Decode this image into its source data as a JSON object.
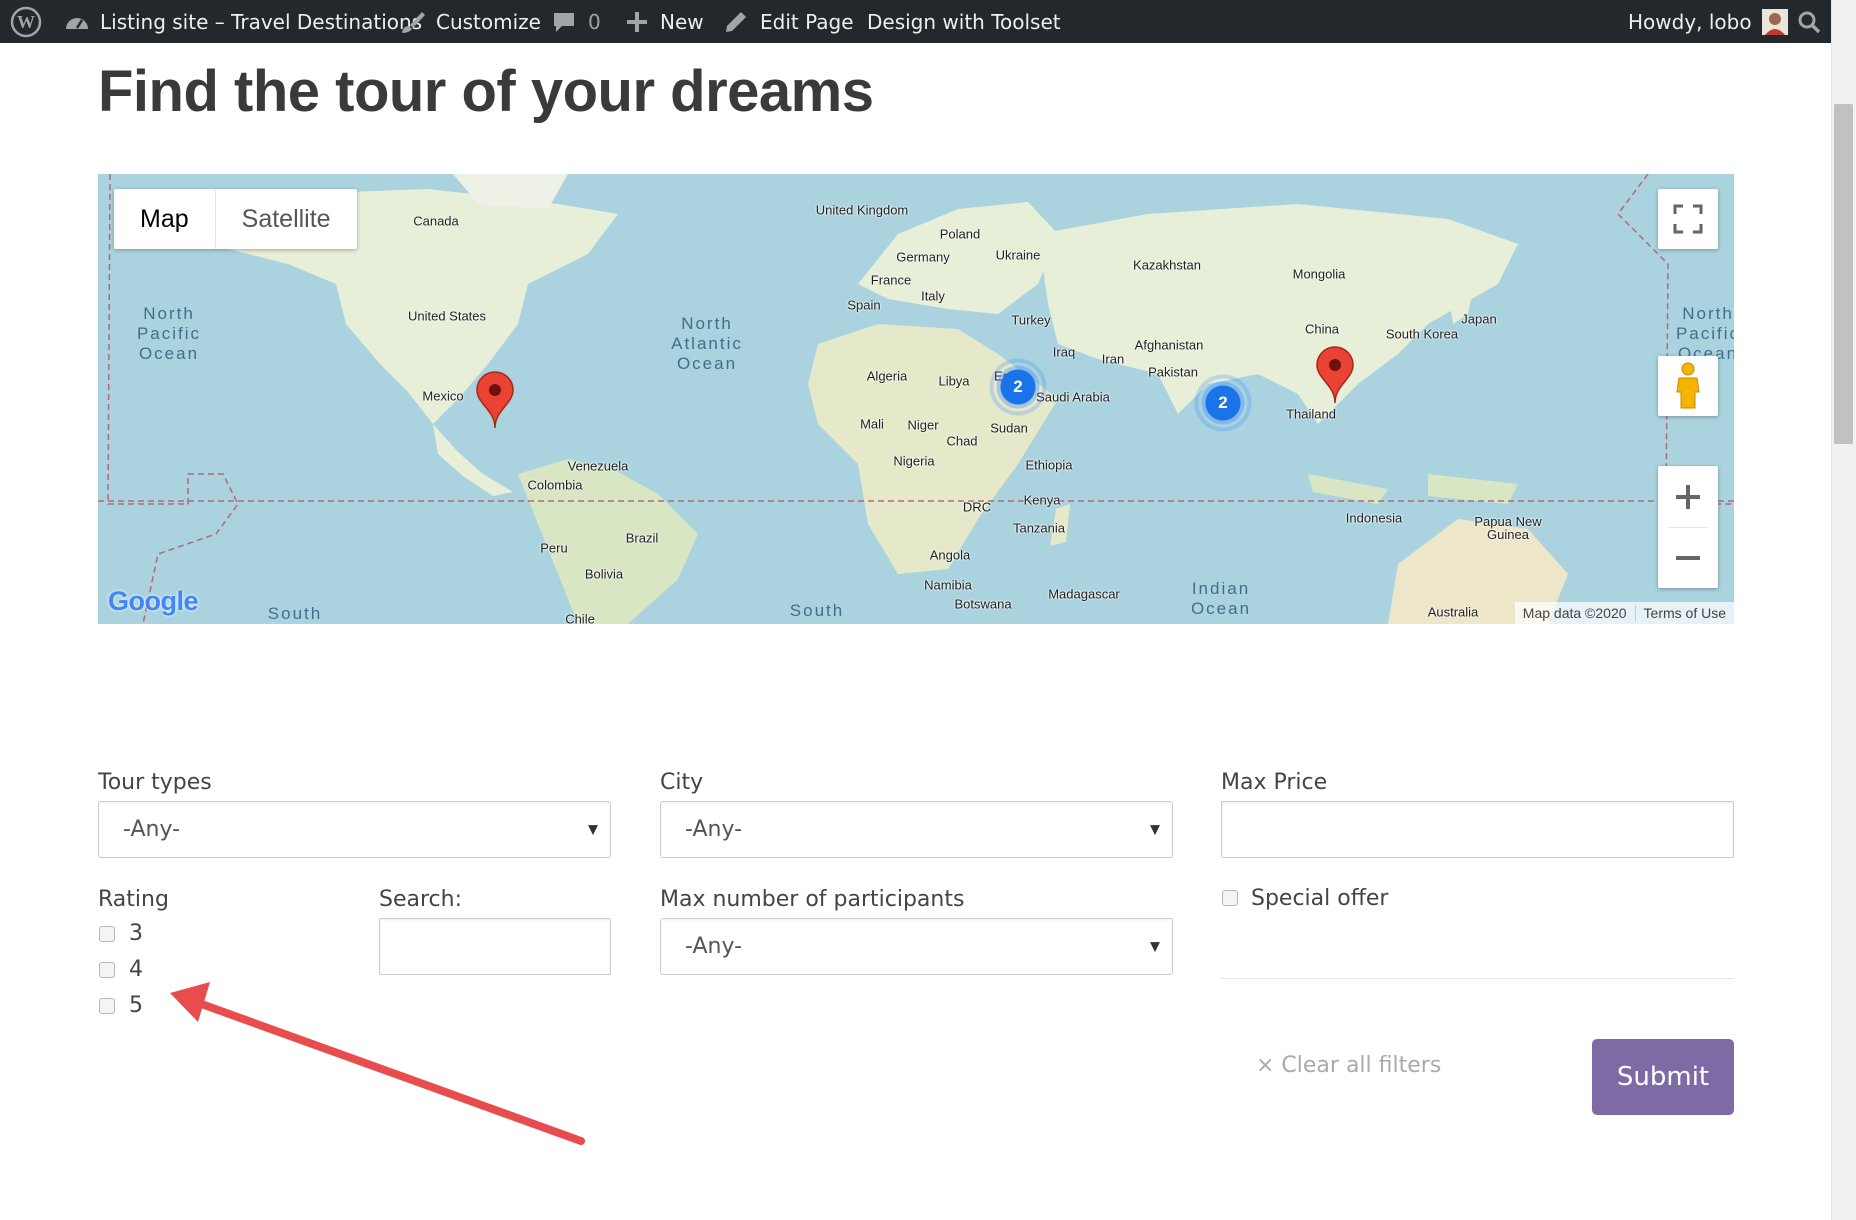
{
  "adminbar": {
    "site_name": "Listing site – Travel Destinations",
    "customize": "Customize",
    "comments_count": "0",
    "new": "New",
    "edit_page": "Edit Page",
    "toolset": "Design with Toolset",
    "howdy": "Howdy, lobo"
  },
  "page": {
    "title": "Find the tour of your dreams"
  },
  "map": {
    "type_map": "Map",
    "type_satellite": "Satellite",
    "attribution": "Map data ©2020",
    "terms": "Terms of Use",
    "logo": "Google",
    "clusters": [
      "2",
      "2"
    ],
    "countries": [
      "Canada",
      "United States",
      "Mexico",
      "Venezuela",
      "Colombia",
      "Peru",
      "Brazil",
      "Bolivia",
      "Chile",
      "United Kingdom",
      "Poland",
      "Germany",
      "Ukraine",
      "France",
      "Italy",
      "Spain",
      "Turkey",
      "Algeria",
      "Libya",
      "Eg",
      "Saudi Arabia",
      "Iraq",
      "Iran",
      "Mali",
      "Niger",
      "Chad",
      "Sudan",
      "Nigeria",
      "Ethiopia",
      "DRC",
      "Kenya",
      "Tanzania",
      "Angola",
      "Namibia",
      "Botswana",
      "Madagascar",
      "Kazakhstan",
      "Mongolia",
      "China",
      "South Korea",
      "Japan",
      "Afghanistan",
      "Pakistan",
      "Thailand",
      "Indonesia",
      "Papua New Guinea",
      "Australia"
    ],
    "oceans": [
      "North\nPacific\nOcean",
      "North\nAtlantic\nOcean",
      "North\nPacific\nOcean",
      "Indian\nOcean",
      "South",
      "South"
    ]
  },
  "form": {
    "tour_types_label": "Tour types",
    "tour_types_value": "-Any-",
    "city_label": "City",
    "city_value": "-Any-",
    "max_price_label": "Max Price",
    "max_price_value": "",
    "rating_label": "Rating",
    "rating_options": [
      "3",
      "4",
      "5"
    ],
    "search_label": "Search:",
    "search_value": "",
    "participants_label": "Max number of participants",
    "participants_value": "-Any-",
    "special_offer_label": "Special offer",
    "clear_filters": "× Clear all filters",
    "submit": "Submit"
  },
  "colors": {
    "adminbar_bg": "#23282d",
    "submit_bg": "#7e6ba5",
    "annotation_arrow": "#e84c4c",
    "water": "#aad3df",
    "land": "#e8efd8"
  }
}
